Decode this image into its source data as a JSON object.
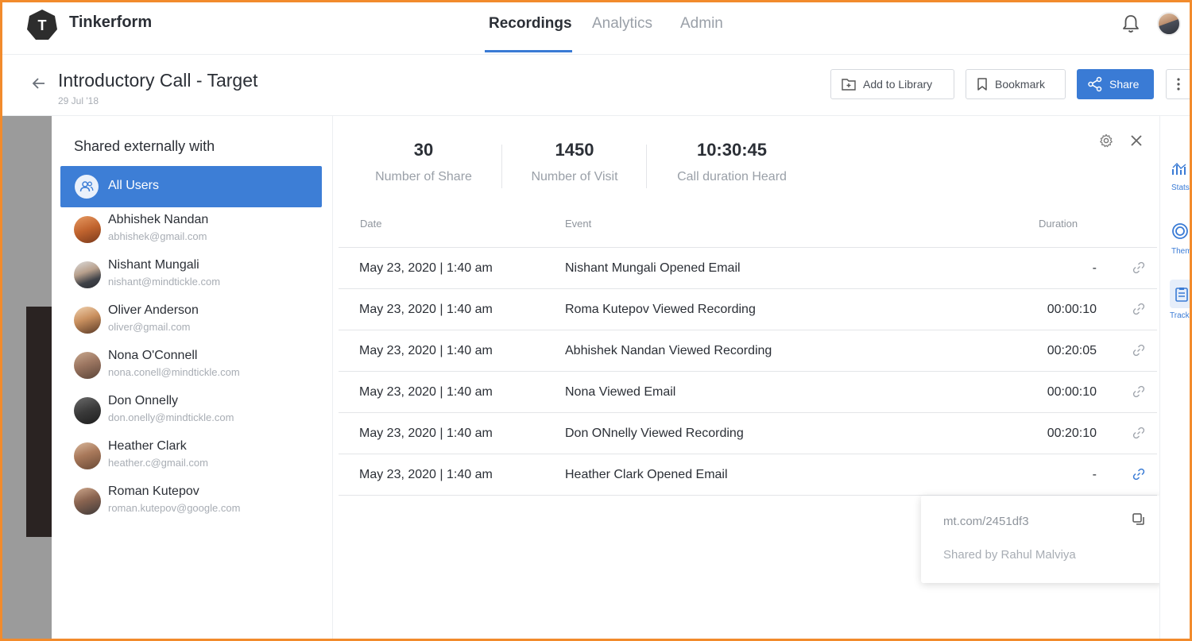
{
  "app": {
    "brand": "Tinkerform",
    "logo_letter": "T",
    "nav": [
      "Recordings",
      "Analytics",
      "Admin"
    ]
  },
  "page": {
    "title": "Introductory Call - Target",
    "date": "29 Jul '18"
  },
  "actions": {
    "add_to_library": "Add to Library",
    "bookmark": "Bookmark",
    "share": "Share"
  },
  "shared_panel": {
    "title": "Shared externally with",
    "all_users": "All Users",
    "users": [
      {
        "name": "Abhishek Nandan",
        "email": "abhishek@gmail.com"
      },
      {
        "name": "Nishant Mungali",
        "email": "nishant@mindtickle.com"
      },
      {
        "name": "Oliver Anderson",
        "email": "oliver@gmail.com"
      },
      {
        "name": "Nona O'Connell",
        "email": "nona.conell@mindtickle.com"
      },
      {
        "name": "Don Onnelly",
        "email": "don.onelly@mindtickle.com"
      },
      {
        "name": "Heather Clark",
        "email": "heather.c@gmail.com"
      },
      {
        "name": "Roman Kutepov",
        "email": "roman.kutepov@google.com"
      }
    ]
  },
  "stats": [
    {
      "value": "30",
      "label": "Number of Share"
    },
    {
      "value": "1450",
      "label": "Number of Visit"
    },
    {
      "value": "10:30:45",
      "label": "Call duration Heard"
    }
  ],
  "table": {
    "headers": {
      "date": "Date",
      "event": "Event",
      "duration": "Duration"
    },
    "rows": [
      {
        "date": "May 23, 2020 | 1:40 am",
        "event": "Nishant Mungali Opened Email",
        "duration": "-"
      },
      {
        "date": "May 23, 2020 | 1:40 am",
        "event": "Roma Kutepov Viewed Recording",
        "duration": "00:00:10"
      },
      {
        "date": "May 23, 2020 | 1:40 am",
        "event": "Abhishek Nandan Viewed Recording",
        "duration": "00:20:05"
      },
      {
        "date": "May 23, 2020 | 1:40 am",
        "event": "Nona Viewed Email",
        "duration": "00:00:10"
      },
      {
        "date": "May 23, 2020 | 1:40 am",
        "event": "Don ONnelly Viewed Recording",
        "duration": "00:20:10"
      },
      {
        "date": "May 23, 2020 | 1:40 am",
        "event": "Heather Clark Opened Email",
        "duration": "-"
      }
    ]
  },
  "popover": {
    "url": "mt.com/2451df3",
    "shared_by": "Shared by Rahul Malviya"
  },
  "right_rail": [
    "Stats",
    "Themes",
    "Track"
  ],
  "colors": {
    "accent": "#3a7bd5",
    "frame": "#f28b2c",
    "text": "#2b2f36",
    "muted": "#9aa0a8"
  }
}
